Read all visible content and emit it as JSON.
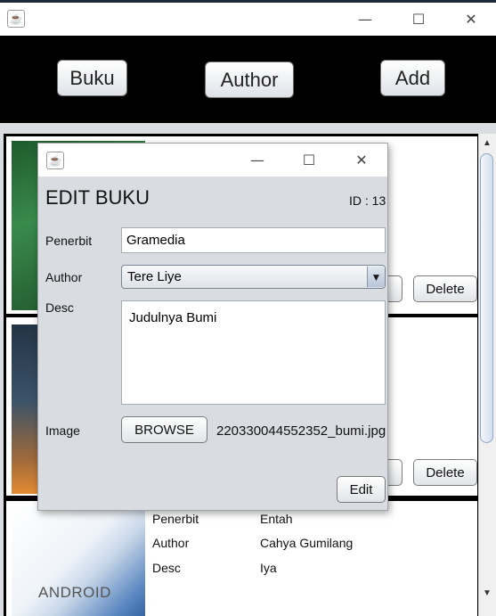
{
  "window": {
    "minimize_glyph": "—",
    "maximize_glyph": "☐",
    "close_glyph": "✕"
  },
  "nav": {
    "buku_label": "Buku",
    "author_label": "Author",
    "add_label": "Add"
  },
  "cards": [
    {
      "edit_label": "",
      "delete_label": "Delete"
    },
    {
      "edit_label": "",
      "delete_label": "Delete"
    },
    {
      "penerbit_label": "Penerbit",
      "penerbit_value": "Entah",
      "author_label": "Author",
      "author_value": "Cahya Gumilang",
      "desc_label": "Desc",
      "desc_value": "Iya",
      "cover_text": "ANDROID"
    }
  ],
  "dialog": {
    "heading": "EDIT BUKU",
    "id_text": "ID : 13",
    "penerbit_label": "Penerbit",
    "penerbit_value": "Gramedia",
    "author_label": "Author",
    "author_value": "Tere Liye",
    "desc_label": "Desc",
    "desc_value": "Judulnya Bumi",
    "image_label": "Image",
    "browse_label": "BROWSE",
    "image_filename": "220330044552352_bumi.jpg",
    "edit_label": "Edit"
  },
  "colors": {
    "navbar": "#000000",
    "panel": "#d9dce1"
  },
  "icons": [
    "java-app-icon",
    "minimize-icon",
    "maximize-icon",
    "close-icon",
    "dropdown-arrow-icon",
    "scroll-up-icon",
    "scroll-down-icon"
  ]
}
